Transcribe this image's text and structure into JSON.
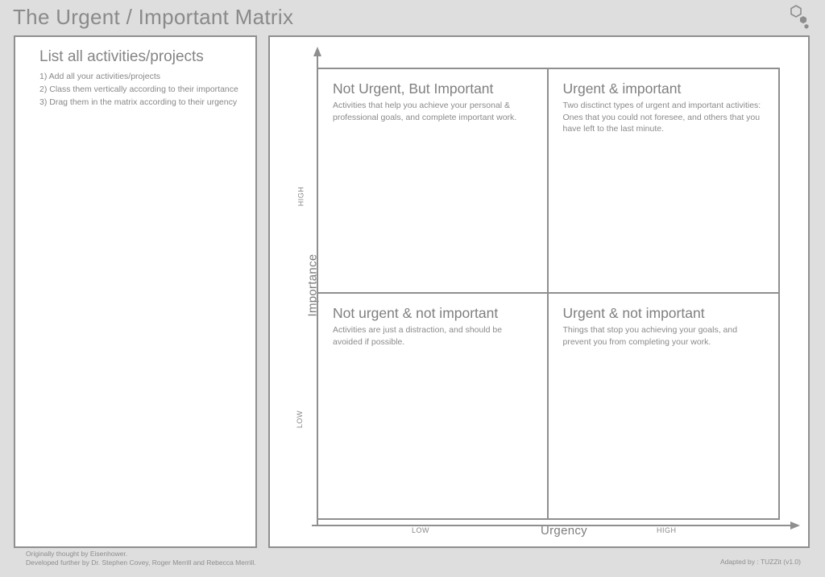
{
  "title": "The Urgent / Important Matrix",
  "left_panel": {
    "heading": "List all activities/projects",
    "steps": [
      "1) Add all your activities/projects",
      "2) Class them vertically according to their importance",
      "3) Drag them in the matrix according to their urgency"
    ]
  },
  "axes": {
    "y_label": "Importance",
    "x_label": "Urgency",
    "y_high": "HIGH",
    "y_low": "LOW",
    "x_low": "LOW",
    "x_high": "HIGH"
  },
  "quadrants": {
    "q1": {
      "title": "Not Urgent, But Important",
      "desc": "Activities that help you achieve your personal & professional goals, and complete important work."
    },
    "q2": {
      "title": "Urgent & important",
      "desc": "Two disctinct types of urgent and important activities: Ones that you could not foresee, and others that you have left to the last minute."
    },
    "q3": {
      "title": "Not urgent & not important",
      "desc": "Activities are just a distraction, and should be avoided if possible."
    },
    "q4": {
      "title": "Urgent & not important",
      "desc": "Things that stop you achieving your goals, and prevent you from completing your work."
    }
  },
  "footer": {
    "credit_line1": "Originally thought by Eisenhower.",
    "credit_line2": "Developed further by Dr. Stephen Covey, Roger Merrill and Rebecca Merrill.",
    "adapted": "Adapted by : TUZZit (v1.0)"
  }
}
